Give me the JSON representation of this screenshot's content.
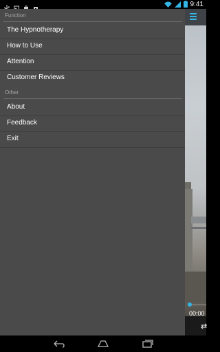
{
  "status_bar": {
    "time": "9:41",
    "icons": [
      "usb-icon",
      "image-icon",
      "store-icon",
      "shop-icon",
      "wifi-icon",
      "signal-icon",
      "battery-icon"
    ]
  },
  "drawer": {
    "sections": [
      {
        "header": "Function",
        "items": [
          "The Hypnotherapy",
          "How to Use",
          "Attention",
          "Customer Reviews"
        ]
      },
      {
        "header": "Other",
        "items": [
          "About",
          "Feedback",
          "Exit"
        ]
      }
    ]
  },
  "player": {
    "current_time": "00:00"
  },
  "colors": {
    "accent": "#33b5e5",
    "drawer_bg": "#4a4a4a"
  }
}
